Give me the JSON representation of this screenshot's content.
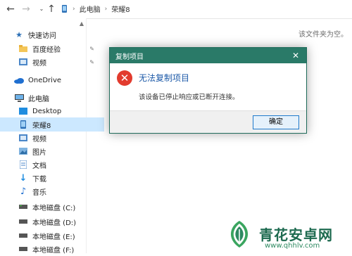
{
  "addressbar": {
    "back_icon": "arrow-left-icon",
    "forward_icon": "arrow-right-icon",
    "recent_icon": "chevron-down-icon",
    "up_icon": "arrow-up-icon",
    "crumbs": [
      "此电脑",
      "荣耀8"
    ]
  },
  "sidebar": {
    "items": [
      {
        "label": "快速访问",
        "icon": "star-icon"
      },
      {
        "label": "百度经验",
        "icon": "folder-icon",
        "pinned": true
      },
      {
        "label": "视频",
        "icon": "video-folder-icon",
        "pinned": true
      },
      {
        "label": "OneDrive",
        "icon": "cloud-icon"
      },
      {
        "label": "此电脑",
        "icon": "computer-icon"
      },
      {
        "label": "Desktop",
        "icon": "desktop-icon"
      },
      {
        "label": "荣耀8",
        "icon": "phone-icon",
        "selected": true
      },
      {
        "label": "视频",
        "icon": "video-folder-icon"
      },
      {
        "label": "图片",
        "icon": "pictures-icon"
      },
      {
        "label": "文档",
        "icon": "documents-icon"
      },
      {
        "label": "下载",
        "icon": "download-icon"
      },
      {
        "label": "音乐",
        "icon": "music-icon"
      },
      {
        "label": "本地磁盘 (C:)",
        "icon": "drive-icon"
      },
      {
        "label": "本地磁盘 (D:)",
        "icon": "drive-icon"
      },
      {
        "label": "本地磁盘 (E:)",
        "icon": "drive-icon"
      },
      {
        "label": "本地磁盘 (F:)",
        "icon": "drive-icon"
      }
    ]
  },
  "main": {
    "empty_message": "该文件夹为空。"
  },
  "dialog": {
    "title": "复制项目",
    "heading": "无法复制项目",
    "message": "该设备已停止响应或已断开连接。",
    "ok_label": "确定",
    "icon": "error-icon"
  },
  "watermark": {
    "title": "青花安卓网",
    "url": "www.qhhlv.com"
  },
  "colors": {
    "dialog_titlebar": "#2a7a68",
    "heading": "#1d5aa8",
    "error": "#e23b2e",
    "selection": "#cce8ff",
    "ok_border": "#1f7acc"
  }
}
